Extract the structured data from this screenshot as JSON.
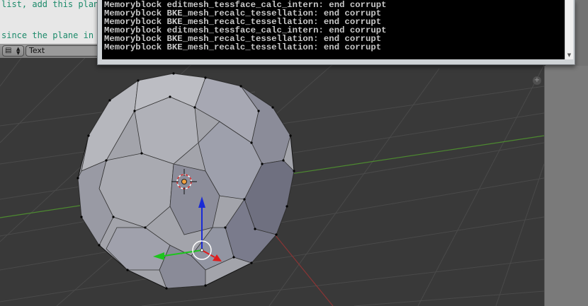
{
  "text_editor": {
    "code_lines": [
      "list, add this plan",
      "since the plane in"
    ],
    "header": {
      "editor_type_icon": "text-editor-icon",
      "text_name": "Text"
    }
  },
  "console": {
    "lines": [
      "Memoryblock editmesh_tessface_calc_intern: end corrupt",
      "Memoryblock BKE_mesh_recalc_tessellation: end corrupt",
      "Memoryblock BKE_mesh_recalc_tessellation: end corrupt",
      "Memoryblock editmesh_tessface_calc_intern: end corrupt",
      "Memoryblock BKE_mesh_recalc_tessellation: end corrupt",
      "Memoryblock BKE_mesh_recalc_tessellation: end corrupt"
    ],
    "scroll_icon": "scroll-down-arrow-icon"
  },
  "viewport": {
    "object": "truncated-icosahedron-mesh",
    "colors": {
      "background": "#393939",
      "face_light": "#a3a4ab",
      "face_dark": "#747585",
      "x_axis": "#8a3535",
      "y_axis": "#5aa03a",
      "manip_z": "#1a2bd6",
      "manip_y": "#1dc41d",
      "manip_x": "#e01c1c"
    },
    "corner_icon": "plus-icon"
  }
}
